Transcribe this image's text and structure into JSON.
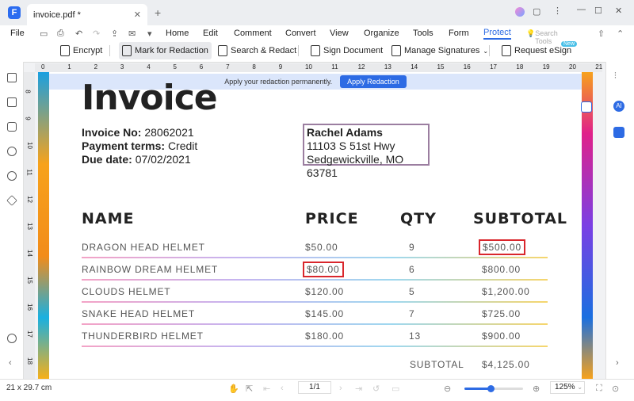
{
  "window": {
    "tab_title": "invoice.pdf *",
    "new_tab": "+"
  },
  "menu": {
    "file": "File",
    "items": [
      "Home",
      "Edit",
      "Comment",
      "Convert",
      "View",
      "Organize",
      "Tools",
      "Form",
      "Protect"
    ],
    "active": "Protect",
    "search_tools": "Search Tools"
  },
  "toolbar": {
    "encrypt": "Encrypt",
    "mark_redaction": "Mark for Redaction",
    "search_redact": "Search & Redact",
    "sign_document": "Sign Document",
    "manage_signatures": "Manage Signatures",
    "request_esign": "Request eSign",
    "new_badge": "New"
  },
  "ruler": {
    "h": [
      "0",
      "1",
      "2",
      "3",
      "4",
      "5",
      "6",
      "7",
      "8",
      "9",
      "10",
      "11",
      "12",
      "13",
      "14",
      "15",
      "16",
      "17",
      "18",
      "19",
      "20",
      "21"
    ],
    "v": [
      "8",
      "9",
      "10",
      "11",
      "12",
      "13",
      "14",
      "15",
      "16",
      "17",
      "18"
    ]
  },
  "banner": {
    "text": "Apply your redaction permanently.",
    "button": "Apply Redaction"
  },
  "invoice": {
    "title": "Invoice",
    "invoice_no_label": "Invoice No:",
    "invoice_no": "28062021",
    "terms_label": "Payment terms:",
    "terms": "Credit",
    "due_label": "Due date:",
    "due": "07/02/2021",
    "client_name": "Rachel Adams",
    "client_street": "11103 S 51st Hwy",
    "client_city": "Sedgewickville, MO 63781",
    "headers": [
      "NAME",
      "PRICE",
      "QTY",
      "SUBTOTAL"
    ],
    "rows": [
      {
        "name": "DRAGON HEAD HELMET",
        "price": "$50.00",
        "qty": "9",
        "subtotal": "$500.00"
      },
      {
        "name": "RAINBOW DREAM HELMET",
        "price": "$80.00",
        "qty": "6",
        "subtotal": "$800.00"
      },
      {
        "name": "CLOUDS HELMET",
        "price": "$120.00",
        "qty": "5",
        "subtotal": "$1,200.00"
      },
      {
        "name": "SNAKE HEAD HELMET",
        "price": "$145.00",
        "qty": "7",
        "subtotal": "$725.00"
      },
      {
        "name": "THUNDERBIRD HELMET",
        "price": "$180.00",
        "qty": "13",
        "subtotal": "$900.00"
      }
    ],
    "subtotal_label": "SUBTOTAL",
    "subtotal_value": "$4,125.00"
  },
  "status": {
    "page_size": "21 x 29.7 cm",
    "page": "1/1",
    "zoom": "125%",
    "zoom_level": 0.45
  },
  "right_panel": {
    "ai": "AI"
  },
  "colors": {
    "accent": "#2d6be4",
    "redaction_box": "#d9262c"
  }
}
